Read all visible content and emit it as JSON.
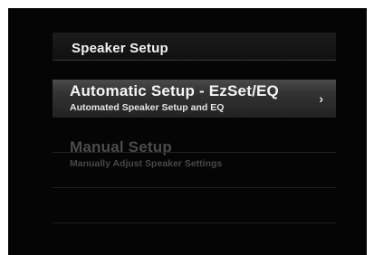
{
  "header": {
    "title": "Speaker Setup"
  },
  "menu": {
    "items": [
      {
        "title": "Automatic Setup - EzSet/EQ",
        "subtitle": "Automated Speaker Setup and EQ",
        "chevron": "›"
      },
      {
        "title": "Manual Setup",
        "subtitle": "Manually Adjust Speaker Settings"
      }
    ]
  }
}
